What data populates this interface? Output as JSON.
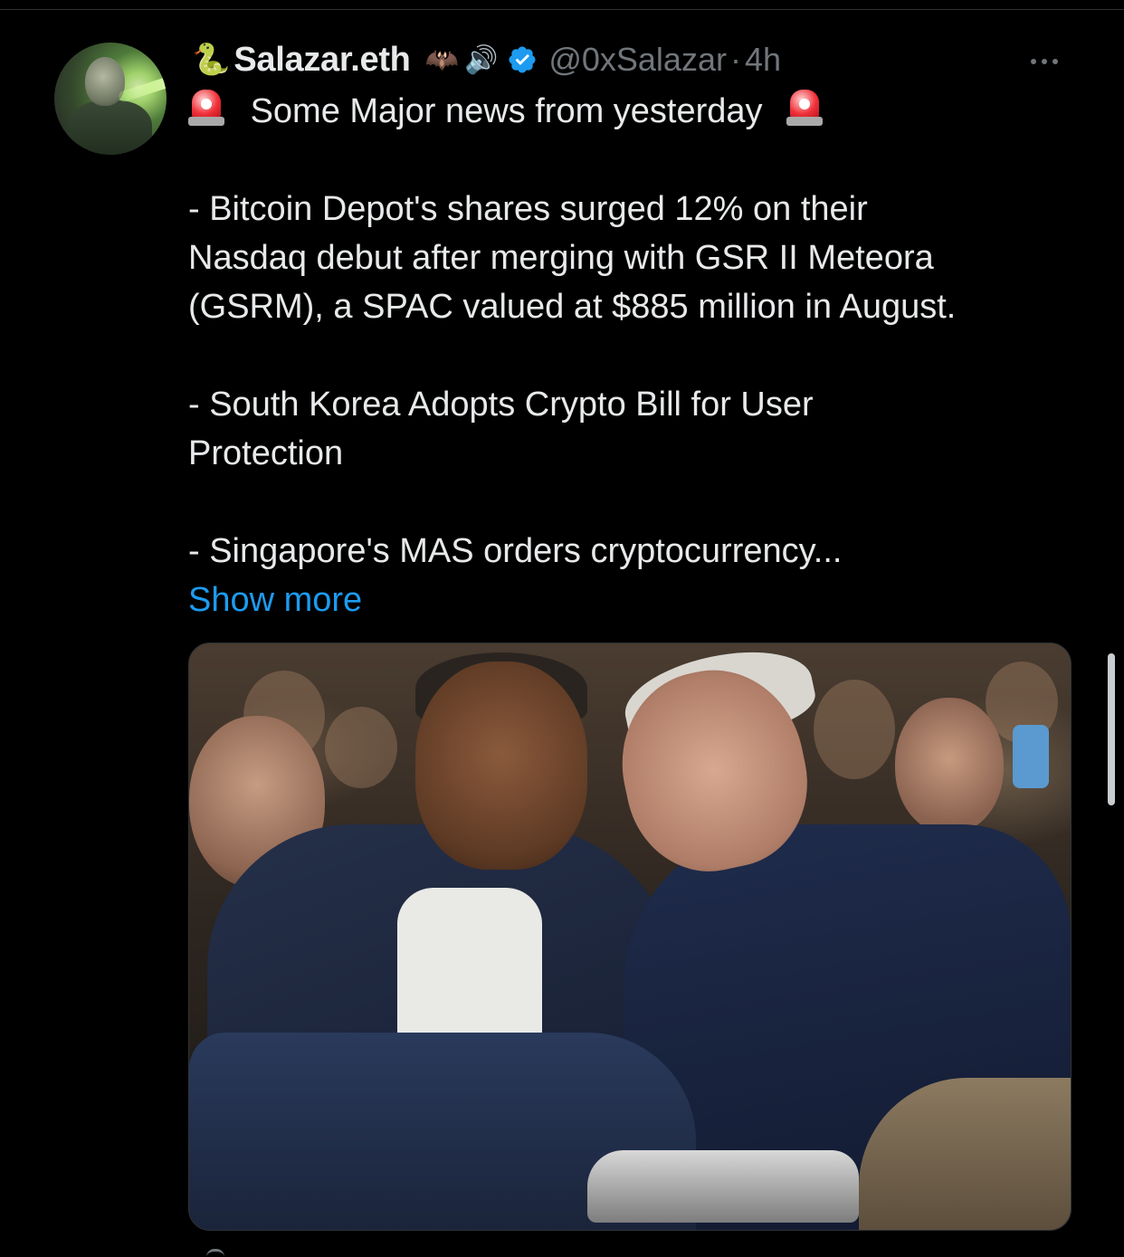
{
  "tweet": {
    "author": {
      "prefix_emoji": "🐍",
      "display_name": "Salazar.eth",
      "name_emojis": [
        "🦇",
        "🔊"
      ],
      "handle": "@0xSalazar",
      "separator": "·",
      "time": "4h",
      "verified": true,
      "verified_color": "#1d9bf0"
    },
    "headline": "Some Major news from yesterday",
    "body_lines": [
      "- Bitcoin Depot's shares surged 12% on their",
      "Nasdaq debut after merging with GSR II Meteora",
      "(GSRM), a SPAC valued at $885 million in August.",
      "- South Korea Adopts Crypto Bill for User",
      "Protection",
      "- Singapore's MAS orders cryptocurrency..."
    ],
    "show_more": "Show more",
    "accent_color": "#1d9bf0"
  },
  "icons": {
    "siren": "police-car-light-icon",
    "more": "more-horizontal-icon",
    "verified": "verified-badge-icon"
  }
}
